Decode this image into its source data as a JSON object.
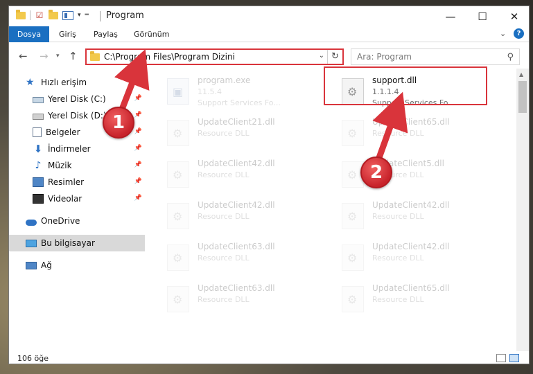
{
  "window": {
    "title": "Program",
    "controls": {
      "minimize": "—",
      "maximize": "☐",
      "close": "✕"
    }
  },
  "ribbon": {
    "tabs": [
      "Dosya",
      "Giriş",
      "Paylaş",
      "Görünüm"
    ]
  },
  "nav": {
    "address": "C:\\Program Files\\Program Dizini",
    "search_placeholder": "Ara: Program"
  },
  "sidebar": {
    "items": [
      {
        "label": "Hızlı erişim",
        "icon": "star-icon"
      },
      {
        "label": "Yerel Disk (C:)",
        "icon": "disk-icon",
        "pinned": true
      },
      {
        "label": "Yerel Disk (D:)",
        "icon": "disk-icon",
        "pinned": true
      },
      {
        "label": "Belgeler",
        "icon": "documents-icon",
        "pinned": true
      },
      {
        "label": "İndirmeler",
        "icon": "download-icon",
        "pinned": true
      },
      {
        "label": "Müzik",
        "icon": "music-icon",
        "pinned": true
      },
      {
        "label": "Resimler",
        "icon": "pictures-icon",
        "pinned": true
      },
      {
        "label": "Videolar",
        "icon": "videos-icon",
        "pinned": true
      },
      {
        "label": "OneDrive",
        "icon": "onedrive-icon"
      },
      {
        "label": "Bu bilgisayar",
        "icon": "computer-icon",
        "selected": true
      },
      {
        "label": "Ağ",
        "icon": "network-icon"
      }
    ]
  },
  "files": [
    {
      "name": "program.exe",
      "line1": "11.5.4",
      "line2": "Support Services Fo..."
    },
    {
      "name": "support.dll",
      "line1": "1.1.1.4",
      "line2": "Support Services Fo..."
    },
    {
      "name": "UpdateClient21.dll",
      "line1": "Resource DLL"
    },
    {
      "name": "UpdateClient65.dll",
      "line1": "Resource DLL"
    },
    {
      "name": "UpdateClient42.dll",
      "line1": "Resource DLL"
    },
    {
      "name": "UpdateClient5.dll",
      "line1": "Resource DLL"
    },
    {
      "name": "UpdateClient42.dll",
      "line1": "Resource DLL"
    },
    {
      "name": "UpdateClient42.dll",
      "line1": "Resource DLL"
    },
    {
      "name": "UpdateClient63.dll",
      "line1": "Resource DLL"
    },
    {
      "name": "UpdateClient42.dll",
      "line1": "Resource DLL"
    },
    {
      "name": "UpdateClient63.dll",
      "line1": "Resource DLL"
    },
    {
      "name": "UpdateClient65.dll",
      "line1": "Resource DLL"
    }
  ],
  "status": {
    "count": "106 öğe"
  },
  "annotations": {
    "badge1": "1",
    "badge2": "2",
    "color": "#d9343b"
  }
}
